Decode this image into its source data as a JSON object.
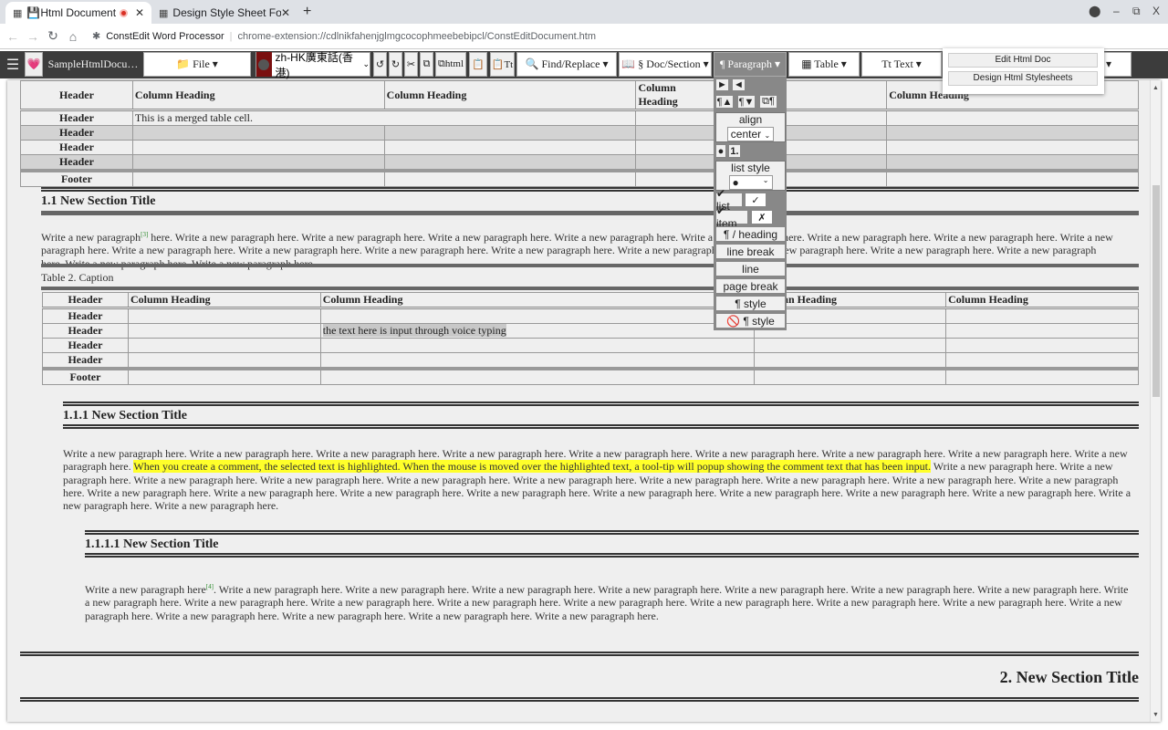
{
  "browser": {
    "tabs": [
      {
        "icon": "editor-icon",
        "title": "💾Html Document",
        "recording": true
      },
      {
        "icon": "editor-icon",
        "title": "Design Style Sheet For Ht"
      }
    ],
    "new_tab": "+",
    "address": {
      "site": "ConstEdit Word Processor",
      "url": "chrome-extension://cdlnikfahenjglmgcocophmeebebipcl/ConstEditDocument.htm"
    },
    "window_controls": {
      "minimize": "–",
      "restore": "⧉",
      "close": "X"
    }
  },
  "toolbar": {
    "doc_name": "SampleHtmlDocu…",
    "file": "📁 File ▾",
    "language": "zh-HK廣東話(香港)",
    "undo": "↺",
    "redo": "↻",
    "cut": "✂",
    "copy": "⧉",
    "copy_html": "⧉html",
    "paste": "📋",
    "paste_text": "📋Tt",
    "find_replace": "🔍 Find/Replace ▾",
    "doc_section": "📖 § Doc/Section ▾",
    "paragraph": "¶ Paragraph ▾",
    "table": "▦ Table ▾",
    "text": "Tt Text ▾",
    "more": "▾"
  },
  "extension_popup": {
    "items": [
      "Edit Html Doc",
      "Design Html Stylesheets"
    ]
  },
  "paragraph_menu": {
    "indent": "►",
    "outdent": "◄",
    "move_up": "¶▲",
    "move_down": "¶▼",
    "copy_para": "⧉¶",
    "align_label": "align",
    "align_value": "center",
    "bullet": "●",
    "numbered": "1.",
    "list_style_label": "list style",
    "list_style_value": "●",
    "list_btn": "✔ list",
    "list_check": "✓",
    "item_btn": "✔ item",
    "item_x": "✗",
    "items": [
      "¶ / heading",
      "line break",
      "line",
      "page break",
      "¶ style",
      "🚫 ¶ style"
    ]
  },
  "document": {
    "table1": {
      "headings": [
        "Header",
        "Column Heading",
        "Column Heading",
        "Column Heading",
        "",
        "Column Heading"
      ],
      "rows": [
        {
          "header": "Header",
          "cell": "This is a merged table cell."
        },
        {
          "header": "Header"
        },
        {
          "header": "Header"
        },
        {
          "header": "Header"
        }
      ],
      "footer": "Footer"
    },
    "section_1_1": {
      "title": "1.1 New Section Title",
      "para_a": "Write a new paragraph",
      "footnote": "[3]",
      "para_b": " here. Write a new paragraph here. Write a new paragraph here. Write a new paragraph here. Write a new paragraph here. Write a new paragraph here. Write a new paragraph here. Write a new paragraph here. Write a new paragraph here. Write a new paragraph here. Write a new paragraph here. Write a new paragraph here. Write a new paragraph here. Write a new paragraph here. Write a new paragraph here. Write a new paragraph here. Write a new paragraph here. Write a new paragraph here. Write a new paragraph here."
    },
    "table2": {
      "caption": "Table 2. Caption",
      "headings": [
        "Header",
        "Column Heading",
        "Column Heading",
        "Column Heading",
        "Column Heading"
      ],
      "rows": [
        {
          "header": "Header"
        },
        {
          "header": "Header",
          "cell": "the text here is input through voice typing"
        },
        {
          "header": "Header"
        },
        {
          "header": "Header"
        }
      ],
      "footer": "Footer"
    },
    "section_1_1_1": {
      "title": "1.1.1 New Section Title",
      "para_a": "Write a new paragraph here. Write a new paragraph here. Write a new paragraph here. Write a new paragraph here. Write a new paragraph here. Write a new paragraph here. Write a new paragraph here. Write a new paragraph here. Write a new paragraph here. ",
      "highlight": "When you create a comment, the selected text is highlighted. When the mouse is moved over the highlighted text, a tool-tip will popup showing the comment text that has been input.",
      "para_b": " Write a new paragraph here. Write a new paragraph here. Write a new paragraph here. Write a new paragraph here. Write a new paragraph here. Write a new paragraph here. Write a new paragraph here. Write a new paragraph here. Write a new paragraph here. Write a new paragraph here. Write a new paragraph here. Write a new paragraph here. Write a new paragraph here. Write a new paragraph here. Write a new paragraph here. Write a new paragraph here. Write a new paragraph here. Write a new paragraph here. Write a new paragraph here. Write a new paragraph here."
    },
    "section_1_1_1_1": {
      "title": "1.1.1.1 New Section Title",
      "para_a": "Write a new paragraph here",
      "footnote": "[4]",
      "para_b": ". Write a new paragraph here. Write a new paragraph here. Write a new paragraph here. Write a new paragraph here. Write a new paragraph here. Write a new paragraph here. Write a new paragraph here. Write a new paragraph here. Write a new paragraph here. Write a new paragraph here. Write a new paragraph here. Write a new paragraph here. Write a new paragraph here. Write a new paragraph here. Write a new paragraph here. Write a new paragraph here. Write a new paragraph here. Write a new paragraph here. Write a new paragraph here. Write a new paragraph here."
    },
    "section_2": {
      "title": "2. New Section Title"
    }
  }
}
